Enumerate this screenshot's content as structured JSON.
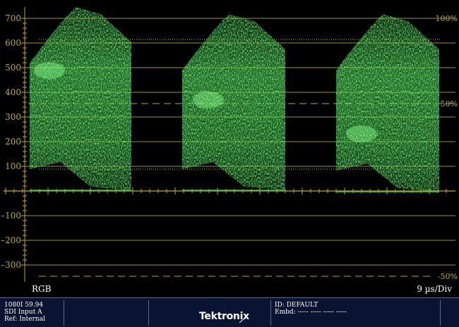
{
  "scale": {
    "left_ticks": [
      700,
      600,
      500,
      400,
      300,
      200,
      100,
      -100,
      -200,
      -300
    ],
    "right_labels": [
      "100%",
      "50%",
      "-50%"
    ]
  },
  "display": {
    "mode": "RGB",
    "time_div": "9 µs/Div"
  },
  "status": {
    "format": "1080I 59.94",
    "input": "SDI Input A",
    "ref": "Ref: Internal",
    "id": "ID: DEFAULT",
    "embd": "Embd: ----- ----- ----- -----",
    "brand": "Tektronix"
  },
  "colors": {
    "graticule": "#b8a92a",
    "trace": "#3fd64a",
    "background": "#000000",
    "status_bg": "#0a1432"
  }
}
